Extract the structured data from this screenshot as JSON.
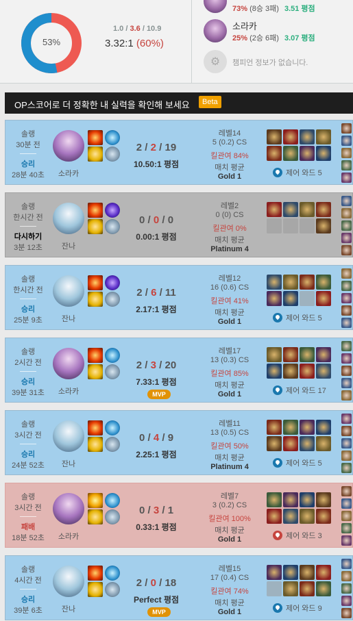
{
  "summary": {
    "winrate_label": "53%",
    "winrate": 53,
    "kda_k": "1.0",
    "kda_d": "3.6",
    "kda_a": "10.9",
    "kda_ratio": "3.32:1",
    "kp": "(60%)",
    "colors": {
      "win": "#1f8ecd",
      "loss": "#ee5a52"
    }
  },
  "champions": [
    {
      "name": "",
      "winrate": "73%",
      "record": "(8승 3패)",
      "kda": "3.51 평점"
    },
    {
      "name": "소라카",
      "winrate": "25%",
      "record": "(2승 6패)",
      "kda": "3.07 평점"
    }
  ],
  "no_champ_msg": "챔피언 정보가 없습니다.",
  "banner": {
    "text": "OP스코어로 더 정확한 내 실력을 확인해 보세요",
    "beta": "Beta"
  },
  "games": [
    {
      "type": "솔랭",
      "time": "30분 전",
      "result": "승리",
      "length": "28분 40초",
      "champ": "소라카",
      "champ_key": "soraka",
      "spells": [
        "ignite",
        "heal"
      ],
      "runes": [
        "exhaust",
        "rn-a",
        "rn-c"
      ],
      "k": "2",
      "d": "2",
      "a": "19",
      "ratio": "10.50:1 평점",
      "mvp": "",
      "level": "레벨14",
      "cs": "5 (0.2) CS",
      "kp": "킬관여 84%",
      "avg": "매치 평균",
      "tier": "Gold 1",
      "ward": "제어 와드 5",
      "outcome": "win"
    },
    {
      "type": "솔랭",
      "time": "한시간 전",
      "result": "다시하기",
      "length": "3분 12초",
      "champ": "잔나",
      "champ_key": "janna",
      "spells": [
        "ignite",
        "rn-b"
      ],
      "runes": [
        "exhaust",
        "rn-a",
        "rn-c"
      ],
      "k": "0",
      "d": "0",
      "a": "0",
      "ratio": "0.00:1 평점",
      "mvp": "",
      "level": "레벨2",
      "cs": "0 (0) CS",
      "kp": "킬관여 0%",
      "avg": "매치 평균",
      "tier": "Platinum 4",
      "ward": "",
      "outcome": "remake"
    },
    {
      "type": "솔랭",
      "time": "한시간 전",
      "result": "승리",
      "length": "25분 9초",
      "champ": "잔나",
      "champ_key": "janna",
      "spells": [
        "ignite",
        "rn-b"
      ],
      "runes": [
        "exhaust",
        "rn-a",
        "rn-c"
      ],
      "k": "2",
      "d": "6",
      "a": "11",
      "ratio": "2.17:1 평점",
      "mvp": "",
      "level": "레벨12",
      "cs": "16 (0.6) CS",
      "kp": "킬관여 41%",
      "avg": "매치 평균",
      "tier": "Gold 1",
      "ward": "제어 와드 5",
      "outcome": "win"
    },
    {
      "type": "솔랭",
      "time": "2시간 전",
      "result": "승리",
      "length": "39분 31초",
      "champ": "소라카",
      "champ_key": "soraka",
      "spells": [
        "ignite",
        "heal"
      ],
      "runes": [
        "exhaust",
        "rn-a",
        "rn-c"
      ],
      "k": "2",
      "d": "3",
      "a": "20",
      "ratio": "7.33:1 평점",
      "mvp": "MVP",
      "level": "레벨17",
      "cs": "13 (0.3) CS",
      "kp": "킬관여 85%",
      "avg": "매치 평균",
      "tier": "Gold 1",
      "ward": "제어 와드 17",
      "outcome": "win"
    },
    {
      "type": "솔랭",
      "time": "3시간 전",
      "result": "승리",
      "length": "24분 52초",
      "champ": "잔나",
      "champ_key": "janna",
      "spells": [
        "ignite",
        "heal"
      ],
      "runes": [
        "exhaust",
        "rn-a",
        "rn-c"
      ],
      "k": "0",
      "d": "4",
      "a": "9",
      "ratio": "2.25:1 평점",
      "mvp": "",
      "level": "레벨11",
      "cs": "13 (0.5) CS",
      "kp": "킬관여 50%",
      "avg": "매치 평균",
      "tier": "Platinum 4",
      "ward": "제어 와드 5",
      "outcome": "win"
    },
    {
      "type": "솔랭",
      "time": "3시간 전",
      "result": "패배",
      "length": "18분 52초",
      "champ": "소라카",
      "champ_key": "soraka",
      "spells": [
        "flash",
        "heal"
      ],
      "runes": [
        "exhaust",
        "rn-a",
        "rn-c"
      ],
      "k": "0",
      "d": "3",
      "a": "1",
      "ratio": "0.33:1 평점",
      "mvp": "",
      "level": "레벨7",
      "cs": "3 (0.2) CS",
      "kp": "킬관여 100%",
      "avg": "매치 평균",
      "tier": "Gold 1",
      "ward": "제어 와드 3",
      "outcome": "loss"
    },
    {
      "type": "솔랭",
      "time": "4시간 전",
      "result": "승리",
      "length": "39분 6초",
      "champ": "잔나",
      "champ_key": "janna",
      "spells": [
        "ignite",
        "heal"
      ],
      "runes": [
        "exhaust",
        "rn-a",
        "rn-c"
      ],
      "k": "2",
      "d": "0",
      "a": "18",
      "ratio": "Perfect 평점",
      "mvp": "MVP",
      "level": "레벨15",
      "cs": "17 (0.4) CS",
      "kp": "킬관여 74%",
      "avg": "매치 평균",
      "tier": "Gold 1",
      "ward": "제어 와드 9",
      "outcome": "win"
    }
  ]
}
